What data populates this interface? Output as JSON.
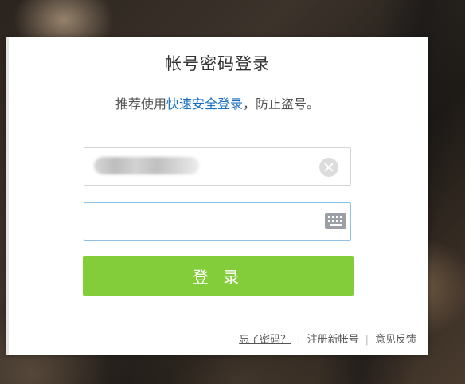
{
  "dialog": {
    "title": "帐号密码登录",
    "subtitle": {
      "prefix": "推荐使用",
      "link": "快速安全登录",
      "suffix": "，防止盗号。"
    },
    "username": {
      "value_obscured": true,
      "clear_icon": "clear-circle-icon"
    },
    "password": {
      "value": "",
      "keyboard_icon": "keyboard-icon",
      "focused": true
    },
    "login_button": "登 录",
    "footer": {
      "forgot_password": "忘了密码？",
      "register": "注册新帐号",
      "feedback": "意见反馈",
      "separator": "|"
    }
  },
  "colors": {
    "accent_green": "#83cd3a",
    "link_blue": "#1a6fc2",
    "focus_border": "#8fc1e8"
  }
}
